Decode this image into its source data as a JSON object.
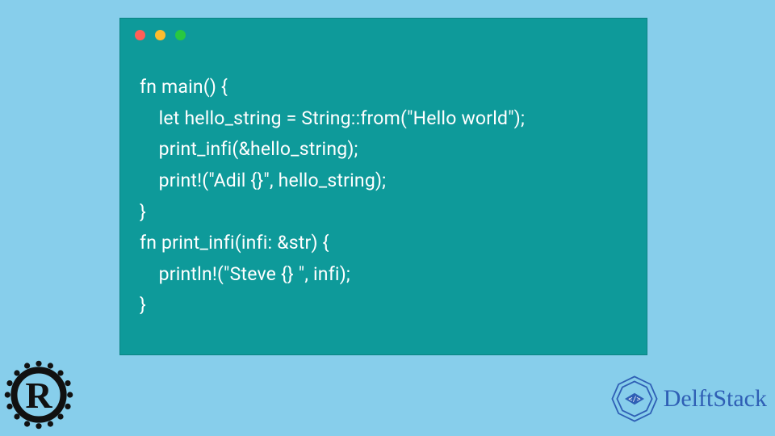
{
  "window": {
    "dots": [
      "red",
      "yellow",
      "green"
    ]
  },
  "code": {
    "language": "rust",
    "lines": [
      "fn main() {",
      "    let hello_string = String::from(\"Hello world\");",
      "    print_infi(&hello_string);",
      "    print!(\"Adil {}\", hello_string);",
      "}",
      "fn print_infi(infi: &str) {",
      "    println!(\"Steve {} \", infi);",
      "}"
    ]
  },
  "logos": {
    "rust": {
      "letter": "R",
      "name": "rust-logo"
    },
    "delftstack": {
      "text": "DelftStack",
      "name": "delftstack-logo"
    }
  },
  "colors": {
    "page_bg": "#87ceeb",
    "code_bg": "#0e9a9a",
    "code_fg": "#ffffff",
    "brand": "#2f5fb5"
  }
}
